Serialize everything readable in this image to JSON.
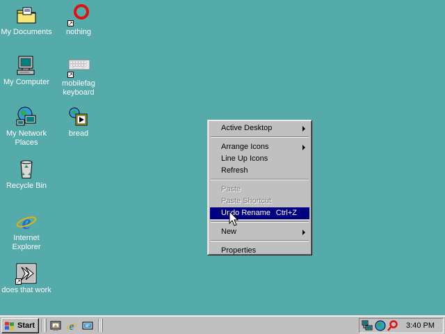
{
  "desktop": {
    "background": "#55aaaa",
    "icons": [
      {
        "label": "My Documents",
        "icon": "folder-documents-icon"
      },
      {
        "label": "nothing",
        "icon": "red-ring-icon",
        "shortcut": true
      },
      {
        "label": "My Computer",
        "icon": "computer-icon"
      },
      {
        "label": "mobilefag\nkeyboard",
        "icon": "keyboard-icon",
        "shortcut": true
      },
      {
        "label": "My Network\nPlaces",
        "icon": "network-icon"
      },
      {
        "label": "bread",
        "icon": "media-icon"
      },
      {
        "label": "Recycle Bin",
        "icon": "recycle-bin-icon"
      },
      {
        "label": "Internet\nExplorer",
        "icon": "internet-explorer-icon"
      },
      {
        "label": "does that work",
        "icon": "shortcut-arrow-icon",
        "shortcut": true
      }
    ]
  },
  "context_menu": {
    "items": [
      {
        "label": "Active Desktop",
        "submenu": true
      },
      {
        "label": "Arrange Icons",
        "submenu": true
      },
      {
        "label": "Line Up Icons"
      },
      {
        "label": "Refresh"
      },
      {
        "label": "Paste",
        "disabled": true
      },
      {
        "label": "Paste Shortcut",
        "disabled": true
      },
      {
        "label": "Undo Rename",
        "shortcut": "Ctrl+Z",
        "selected": true
      },
      {
        "label": "New",
        "submenu": true
      },
      {
        "label": "Properties"
      }
    ],
    "highlight_color": "#000080"
  },
  "taskbar": {
    "start_label": "Start",
    "quick_launch": [
      "show-desktop-icon",
      "internet-explorer-icon",
      "channels-icon"
    ],
    "tray_icons": [
      "network-tray-icon",
      "globe-tray-icon",
      "red-ring-tray-icon"
    ],
    "clock": "3:40 PM"
  }
}
